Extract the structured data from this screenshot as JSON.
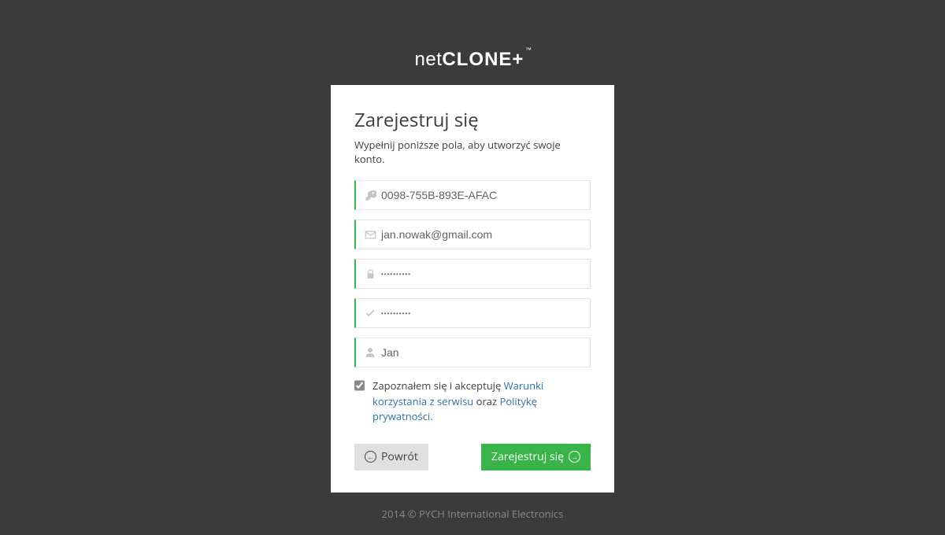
{
  "brand": {
    "part1": "net",
    "part2": "CLONE",
    "plus": "+",
    "tm": "™"
  },
  "card": {
    "title": "Zarejestruj się",
    "subtitle": "Wypełnij poniższe pola, aby utworzyć swoje konto.",
    "fields": {
      "serial": {
        "value": "0098-755B-893E-AFAC",
        "placeholder": ""
      },
      "email": {
        "value": "jan.nowak@gmail.com",
        "placeholder": ""
      },
      "password": {
        "value": "••••••••••",
        "placeholder": ""
      },
      "confirm": {
        "value": "••••••••••",
        "placeholder": ""
      },
      "name": {
        "value": "Jan",
        "placeholder": ""
      }
    },
    "terms": {
      "checked": true,
      "prefix": "Zapoznałem się i akceptuję ",
      "link1": "Warunki korzystania z serwisu",
      "mid": " oraz ",
      "link2": "Politykę prywatności",
      "suffix": "."
    },
    "buttons": {
      "back": "Powrót",
      "submit": "Zarejestruj się"
    }
  },
  "footer": "2014 © PYCH International Electronics"
}
